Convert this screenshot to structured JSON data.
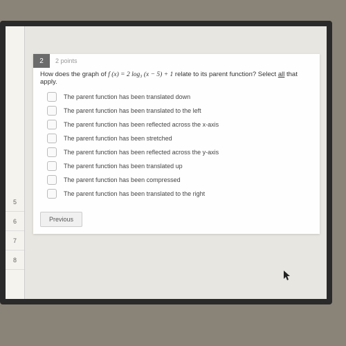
{
  "sidebar": {
    "items": [
      "5",
      "6",
      "7",
      "8"
    ]
  },
  "question": {
    "number": "2",
    "points": "2 points",
    "text_before": "How does the graph of ",
    "formula": "f (x) = 2 log₃ (x − 5) + 1",
    "text_after": " relate to its parent function? Select ",
    "text_all": "all",
    "text_end": " that apply.",
    "options": [
      "The parent function has been translated down",
      "The parent function has been translated to the left",
      "The parent function has been reflected across the x-axis",
      "The parent function has been stretched",
      "The parent function has been reflected across the y-axis",
      "The parent function has been translated up",
      "The parent function has been compressed",
      "The parent function has been translated to the right"
    ]
  },
  "buttons": {
    "previous": "Previous"
  }
}
